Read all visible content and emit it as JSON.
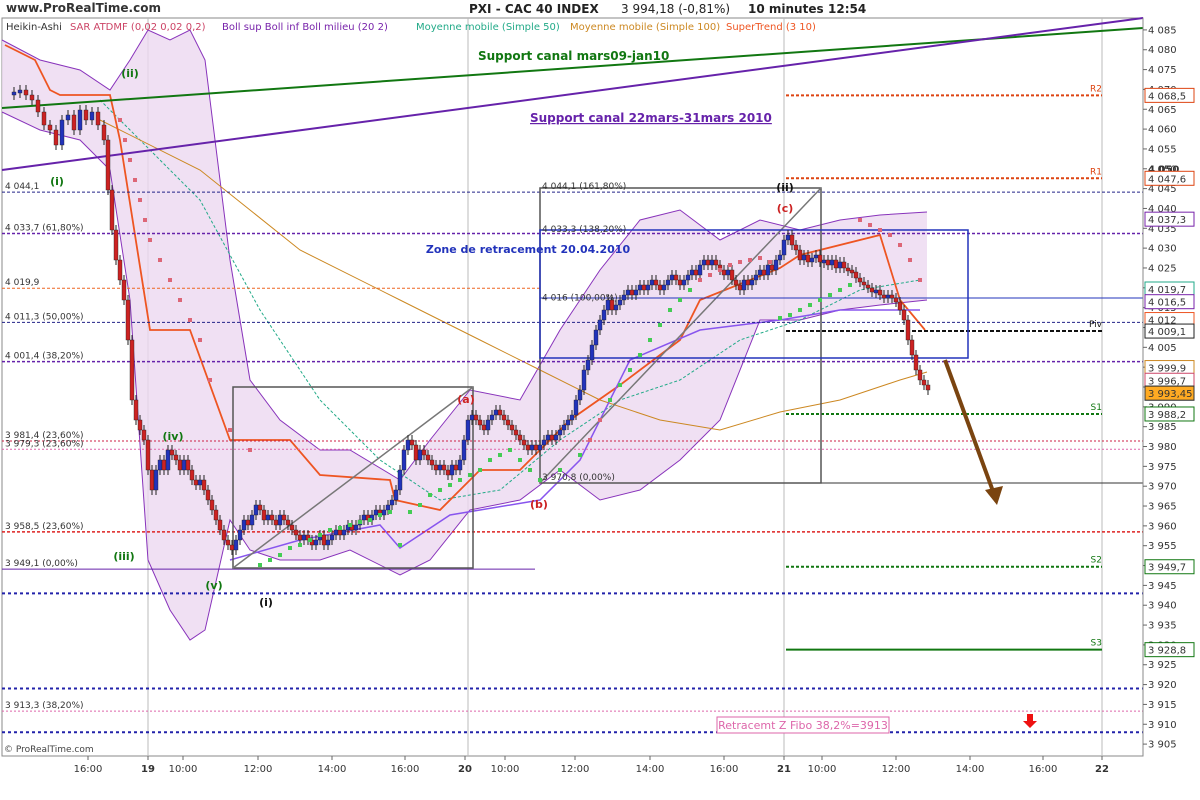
{
  "header": {
    "site": "www.ProRealTime.com",
    "title": "PXI - CAC 40 INDEX",
    "last": "3 994,18 (-0,81%)",
    "interval": "10 minutes",
    "time": "12:54",
    "copyright": "© ProRealTime.com"
  },
  "indicators": [
    {
      "label": "Heikin-Ashi",
      "color": "#333333"
    },
    {
      "label": "SAR ATDMF (0,02 0,02 0,2)",
      "color": "#cc4466"
    },
    {
      "label": "Boll sup Boll inf Boll milieu (20 2)",
      "color": "#7722aa"
    },
    {
      "label": "Moyenne mobile (Simple 50)",
      "color": "#22aa88"
    },
    {
      "label": "Moyenne mobile (Simple 100)",
      "color": "#cc8822"
    },
    {
      "label": "SuperTrend (3 10)",
      "color": "#ee5522"
    }
  ],
  "colors": {
    "up_candle": "#2233bb",
    "down_candle": "#cc2222",
    "green_channel": "#117711",
    "purple_channel": "#6622aa",
    "fibo_left": "#222288",
    "bollinger_fill": "#ecd8f0",
    "arrow": "#7a4410"
  },
  "chart_data": {
    "type": "candlestick",
    "ylim": [
      3902,
      4088
    ],
    "y_ticks": [
      3905,
      3910,
      3915,
      3920,
      3925,
      3930,
      3935,
      3940,
      3945,
      3950,
      3955,
      3960,
      3965,
      3970,
      3975,
      3980,
      3985,
      3990,
      3995,
      4000,
      4005,
      4010,
      4015,
      4020,
      4025,
      4030,
      4035,
      4040,
      4045,
      4050,
      4055,
      4060,
      4065,
      4070,
      4075,
      4080,
      4085
    ],
    "y_tick_labels": [
      "3 905",
      "3 910",
      "3 915",
      "3 920",
      "3 925",
      "3 930",
      "3 935",
      "3 940",
      "3 945",
      "3 950",
      "3 955",
      "3 960",
      "3 965",
      "3 970",
      "3 975",
      "3 980",
      "3 985",
      "3 990",
      "3 995",
      "4 000",
      "4 005",
      "4 010",
      "4 015",
      "4 020",
      "4 025",
      "4 030",
      "4 035",
      "4 040",
      "4 045",
      "4 050",
      "4 055",
      "4 060",
      "4 065",
      "4 070",
      "4 075",
      "4 080",
      "4 085"
    ],
    "x_time_labels": [
      "16:00",
      "19",
      "10:00",
      "12:00",
      "14:00",
      "16:00",
      "20",
      "10:00",
      "12:00",
      "14:00",
      "16:00",
      "21",
      "10:00",
      "12:00",
      "14:00",
      "16:00",
      "22"
    ],
    "price_badges": [
      {
        "label": "4 068,5",
        "value": 4068.5,
        "color": "#dd4411"
      },
      {
        "label": "4 047,6",
        "value": 4047.6,
        "color": "#dd4411"
      },
      {
        "label": "4 037,3",
        "value": 4037.3,
        "color": "#7722aa"
      },
      {
        "label": "4 019,7",
        "value": 4019.7,
        "color": "#22aa88"
      },
      {
        "label": "4 016,5",
        "value": 4016.5,
        "color": "#7722aa"
      },
      {
        "label": "4 012",
        "value": 4012.0,
        "color": "#ee5522"
      },
      {
        "label": "4 009,1",
        "value": 4009.1,
        "color": "#222222"
      },
      {
        "label": "3 999,9",
        "value": 3999.9,
        "color": "#cc8822"
      },
      {
        "label": "3 996,7",
        "value": 3996.7,
        "color": "#cc4466"
      },
      {
        "label": "3 993,45",
        "value": 3993.45,
        "color": "#222222"
      },
      {
        "label": "3 988,2",
        "value": 3988.2,
        "color": "#117711"
      },
      {
        "label": "3 949,7",
        "value": 3949.7,
        "color": "#117711"
      },
      {
        "label": "3 928,8",
        "value": 3928.8,
        "color": "#117711"
      }
    ],
    "pivots": [
      {
        "label": "R2",
        "value": 4068.5
      },
      {
        "label": "R1",
        "value": 4047.6
      },
      {
        "label": "Piv",
        "value": 4009.1
      },
      {
        "label": "S1",
        "value": 3988.2
      },
      {
        "label": "S2",
        "value": 3949.7
      },
      {
        "label": "S3",
        "value": 3928.8
      }
    ],
    "fibo_left": [
      {
        "label": "4 044,1",
        "value": 4044.1
      },
      {
        "label": "4 033,7 (61,80%)",
        "value": 4033.7
      },
      {
        "label": "4 019,9",
        "value": 4019.9
      },
      {
        "label": "4 011,3 (50,00%)",
        "value": 4011.3
      },
      {
        "label": "4 001,4 (38,20%)",
        "value": 4001.4
      },
      {
        "label": "3 981,4 (23,60%)",
        "value": 3981.4
      },
      {
        "label": "3 979,3 (23,60%)",
        "value": 3979.3
      },
      {
        "label": "3 958,5 (23,60%)",
        "value": 3958.5
      },
      {
        "label": "3 949,1 (0,00%)",
        "value": 3949.1
      },
      {
        "label": "3 913,3 (38,20%)",
        "value": 3913.3
      }
    ],
    "fibo_right": [
      {
        "label": "4 044,1 (161,80%)",
        "value": 4044.1
      },
      {
        "label": "4 033,3 (138,20%)",
        "value": 4033.3
      },
      {
        "label": "4 016 (100,00%)",
        "value": 4016.0
      },
      {
        "label": "3 970,8 (0,00%)",
        "value": 3970.8
      }
    ],
    "annotations": {
      "support1": "Support canal mars09-jan10",
      "support2": "Support canal 22mars-31mars 2010",
      "zone": "Zone de retracement 20.04.2010",
      "retracement": "Retracemt Z Fibo 38,2%=3913",
      "waves": [
        "(ii)",
        "(i)",
        "(iv)",
        "(iii)",
        "(v)",
        "(i)",
        "(a)",
        "(b)",
        "(c)",
        "(ii)"
      ]
    }
  }
}
